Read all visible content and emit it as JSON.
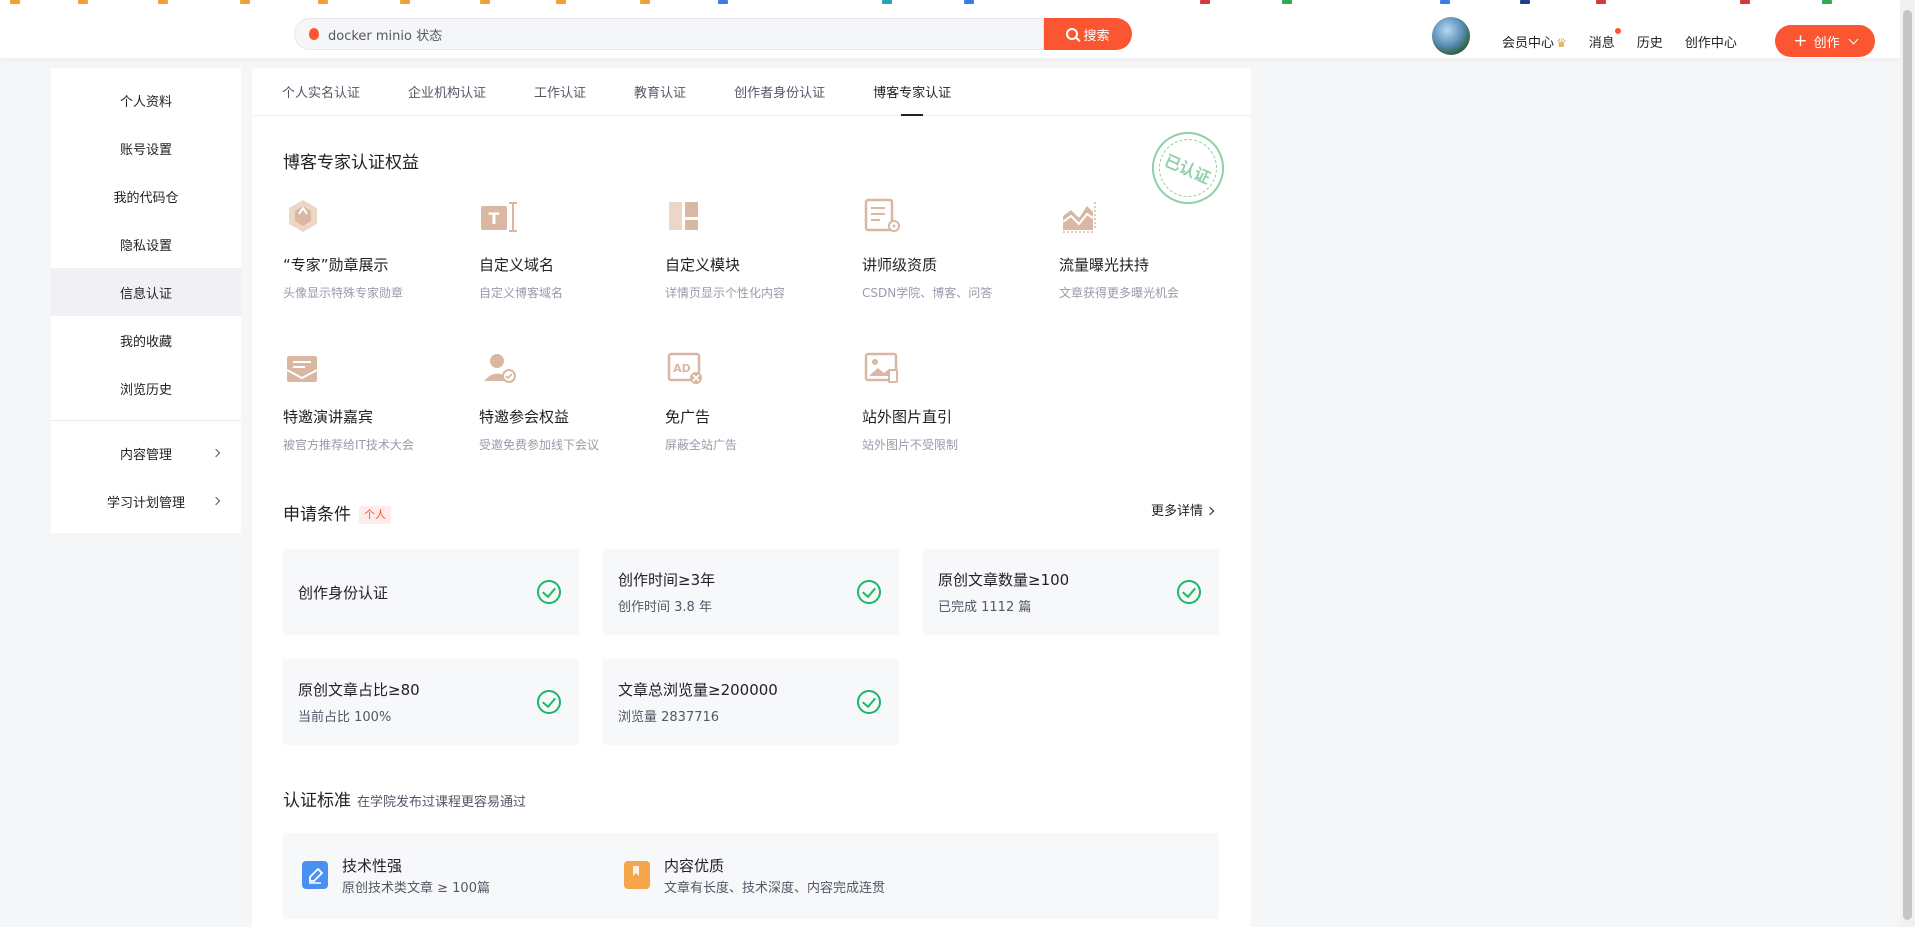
{
  "search": {
    "query": "docker minio 状态",
    "button_label": "搜索"
  },
  "topnav": {
    "vip_center": "会员中心",
    "messages": "消息",
    "history": "历史",
    "creator_center": "创作中心",
    "create_label": "创作"
  },
  "sidebar": {
    "items": [
      {
        "label": "个人资料"
      },
      {
        "label": "账号设置"
      },
      {
        "label": "我的代码仓"
      },
      {
        "label": "隐私设置"
      },
      {
        "label": "信息认证"
      },
      {
        "label": "我的收藏"
      },
      {
        "label": "浏览历史"
      }
    ],
    "groups": [
      {
        "label": "内容管理"
      },
      {
        "label": "学习计划管理"
      }
    ],
    "active": "信息认证"
  },
  "tabs": [
    {
      "label": "个人实名认证"
    },
    {
      "label": "企业机构认证"
    },
    {
      "label": "工作认证"
    },
    {
      "label": "教育认证"
    },
    {
      "label": "创作者身份认证"
    },
    {
      "label": "博客专家认证"
    }
  ],
  "active_tab": "博客专家认证",
  "benefits": {
    "title": "博客专家认证权益",
    "stamp_text": "已认证",
    "items": [
      {
        "name": "“专家”勋章展示",
        "desc": "头像显示特殊专家勋章",
        "icon": "medal-icon"
      },
      {
        "name": "自定义域名",
        "desc": "自定义博客域名",
        "icon": "text-domain-icon"
      },
      {
        "name": "自定义模块",
        "desc": "详情页显示个性化内容",
        "icon": "module-icon"
      },
      {
        "name": "讲师级资质",
        "desc": "CSDN学院、博客、问答",
        "icon": "lecturer-icon"
      },
      {
        "name": "流量曝光扶持",
        "desc": "文章获得更多曝光机会",
        "icon": "traffic-chart-icon"
      },
      {
        "name": "特邀演讲嘉宾",
        "desc": "被官方推荐给IT技术大会",
        "icon": "speaker-invite-icon"
      },
      {
        "name": "特邀参会权益",
        "desc": "受邀免费参加线下会议",
        "icon": "conference-icon"
      },
      {
        "name": "免广告",
        "desc": "屏蔽全站广告",
        "icon": "no-ad-icon"
      },
      {
        "name": "站外图片直引",
        "desc": "站外图片不受限制",
        "icon": "image-link-icon"
      }
    ]
  },
  "conditions": {
    "title": "申请条件",
    "badge": "个人",
    "more_link": "更多详情",
    "items": [
      {
        "title": "创作身份认证",
        "sub": ""
      },
      {
        "title": "创作时间≥3年",
        "sub": "创作时间 3.8 年"
      },
      {
        "title": "原创文章数量≥100",
        "sub": "已完成 1112 篇"
      },
      {
        "title": "原创文章占比≥80",
        "sub": "当前占比 100%"
      },
      {
        "title": "文章总浏览量≥200000",
        "sub": "浏览量 2837716"
      }
    ]
  },
  "standards": {
    "title": "认证标准",
    "subtitle": "在学院发布过课程更容易通过",
    "items": [
      {
        "name": "技术性强",
        "desc": "原创技术类文章 ≥ 100篇",
        "icon": "pencil-icon"
      },
      {
        "name": "内容优质",
        "desc": "文章有长度、技术深度、内容完成连贯",
        "icon": "bookmark-icon"
      }
    ]
  },
  "colors": {
    "brand": "#fc5531",
    "success": "#1db665",
    "benefit_icon": "#d9b7a2",
    "standard_blue": "#4a90f0",
    "standard_orange": "#f5a54a"
  }
}
